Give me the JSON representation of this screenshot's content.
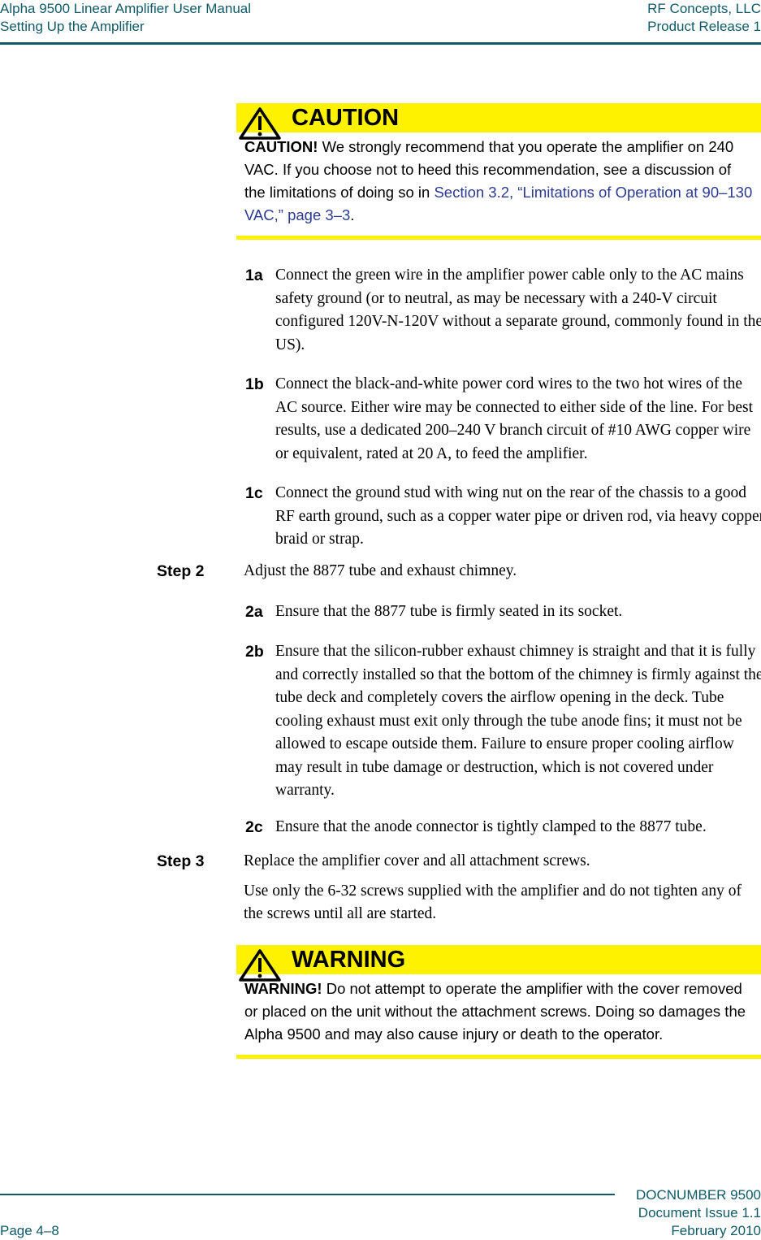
{
  "header": {
    "manual_title": "Alpha 9500 Linear Amplifier User Manual",
    "chapter_title": "Setting Up the Amplifier",
    "company": "RF Concepts, LLC",
    "release": "Product Release 1"
  },
  "caution": {
    "icon": "warning-triangle-icon",
    "title": "CAUTION",
    "lead": "CAUTION!",
    "text": "  We strongly recommend that you operate the amplifier on 240 VAC. If you choose not to heed this recommendation, see a discussion of the limitations of doing so in ",
    "link": "Section 3.2, “Limitations of Operation at 90–130 VAC,” page 3–3",
    "end": ".",
    "accent_color": "#fff200"
  },
  "substeps_1": [
    {
      "num": "1a",
      "text": "Connect the green wire in the amplifier power cable only to the AC mains safety ground (or to neutral, as may be necessary with a 240-V circuit configured 120V-N-120V without a separate ground, commonly found in the US)."
    },
    {
      "num": "1b",
      "text": "Connect the black-and-white power cord wires to the two hot wires of the AC source. Either wire may be connected to either side of the line. For best results, use a dedicated 200–240 V branch circuit of #10 AWG copper wire or equivalent, rated at 20 A, to feed the amplifier."
    },
    {
      "num": "1c",
      "text": "Connect the ground stud with wing nut on the rear of the chassis to a good RF earth ground, such as a copper water pipe or driven rod, via heavy copper braid or strap."
    }
  ],
  "step2": {
    "label": "Step 2",
    "text": "Adjust the 8877 tube and exhaust chimney.",
    "substeps": [
      {
        "num": "2a",
        "text": "Ensure that the 8877 tube is firmly seated in its socket."
      },
      {
        "num": "2b",
        "text": "Ensure that the silicon-rubber exhaust chimney is straight and that it is fully and correctly installed so that the bottom of the chimney is firmly against the tube deck and completely covers the airflow opening in the deck. Tube cooling exhaust must exit only through the tube anode fins; it must not be allowed to escape outside them. Failure to ensure proper cooling airflow may result in tube damage or destruction, which is not covered under warranty."
      },
      {
        "num": "2c",
        "text": "Ensure that the anode connector is tightly clamped to the 8877 tube."
      }
    ]
  },
  "step3": {
    "label": "Step 3",
    "text": "Replace the amplifier cover and all attachment screws.",
    "note": "Use only the 6-32 screws supplied with the amplifier and do not tighten any of the screws until all are started."
  },
  "warning": {
    "icon": "warning-triangle-icon",
    "title": "WARNING",
    "lead": "WARNING!",
    "text": "  Do not attempt to operate the amplifier with the cover removed or placed on the unit without the attachment screws. Doing so damages the Alpha 9500 and may also cause injury or death to the operator."
  },
  "footer": {
    "doc_number": "DOCNUMBER 9500",
    "issue": "Document Issue 1.1",
    "date": "February 2010",
    "page": "Page 4–8"
  }
}
